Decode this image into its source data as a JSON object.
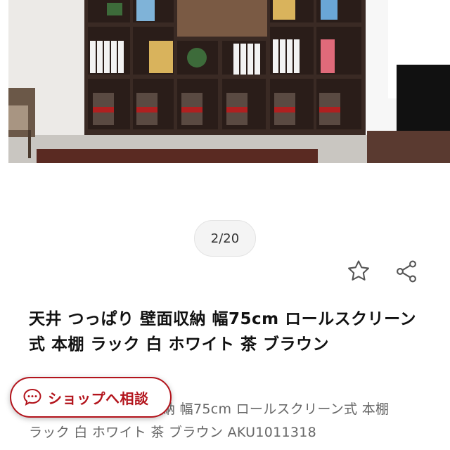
{
  "gallery": {
    "pager_text": "2/20"
  },
  "actions": {
    "favorite_icon": "star-outline-icon",
    "share_icon": "share-icon"
  },
  "product": {
    "title": "天井 つっぱり 壁面収納 幅75cm ロールスクリーン式 本棚 ラック 白 ホワイト 茶 ブラウン",
    "subtitle_visible": "納 幅75cm ロールスクリーン式 本棚\nラック 白 ホワイト 茶 ブラウン AKU1011318"
  },
  "shop_consult": {
    "label": "ショップへ相談",
    "icon": "chat-bubble-icon",
    "accent_color": "#b3141c"
  }
}
